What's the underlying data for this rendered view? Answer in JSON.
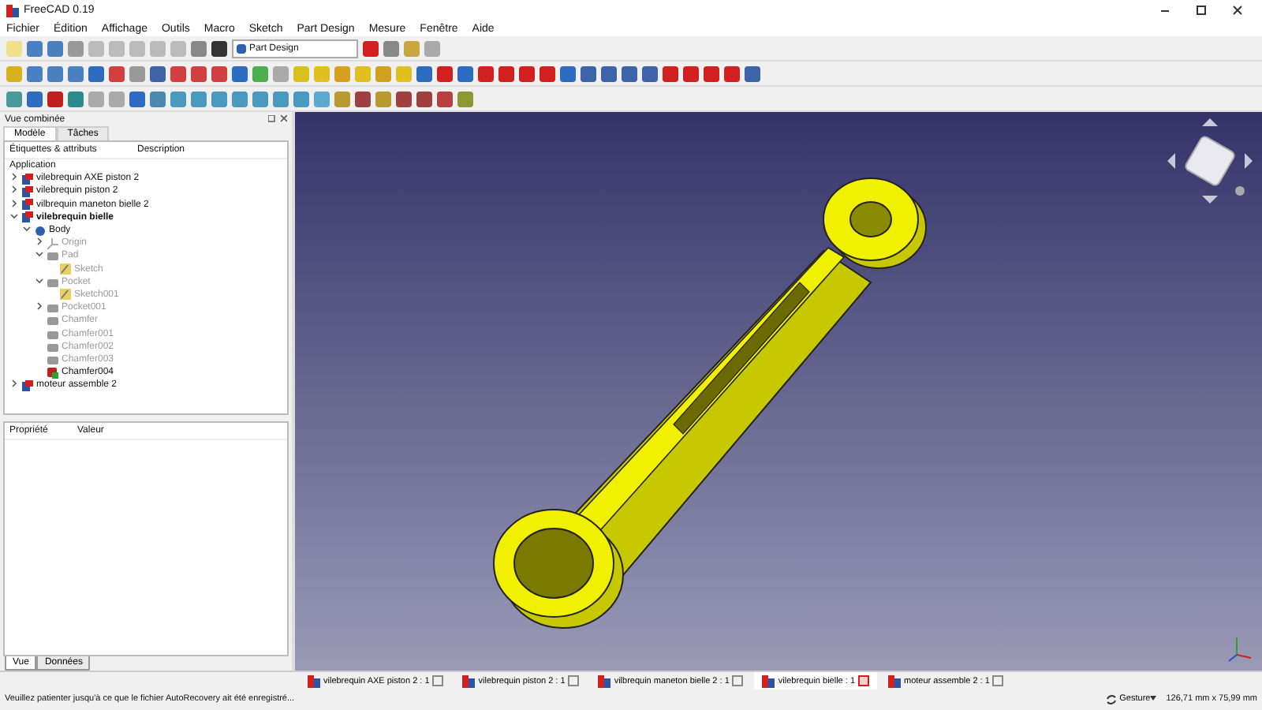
{
  "window": {
    "title": "FreeCAD 0.19"
  },
  "menu": [
    "Fichier",
    "Édition",
    "Affichage",
    "Outils",
    "Macro",
    "Sketch",
    "Part Design",
    "Mesure",
    "Fenêtre",
    "Aide"
  ],
  "workbench": {
    "value": "Part Design"
  },
  "combo_view": {
    "title": "Vue combinée",
    "tabs": [
      {
        "label": "Modèle",
        "selected": true
      },
      {
        "label": "Tâches",
        "selected": false
      }
    ],
    "tree": {
      "columns": [
        "Étiquettes & attributs",
        "Description"
      ],
      "root": "Application",
      "items": [
        {
          "label": "vilebrequin AXE piston 2",
          "kind": "document",
          "expanded": false,
          "active": false,
          "visible": true
        },
        {
          "label": "vilebrequin piston 2",
          "kind": "document",
          "expanded": false,
          "active": false,
          "visible": true
        },
        {
          "label": "vilbrequin maneton bielle 2",
          "kind": "document",
          "expanded": false,
          "active": false,
          "visible": true
        },
        {
          "label": "vilebrequin bielle",
          "kind": "document",
          "expanded": true,
          "active": true,
          "visible": true,
          "children": [
            {
              "label": "Body",
              "kind": "body",
              "expanded": true,
              "active": false,
              "visible": true,
              "children": [
                {
                  "label": "Origin",
                  "kind": "origin",
                  "expanded": false,
                  "active": false,
                  "visible": false
                },
                {
                  "label": "Pad",
                  "kind": "feature",
                  "expanded": true,
                  "active": false,
                  "visible": false,
                  "children": [
                    {
                      "label": "Sketch",
                      "kind": "sketch",
                      "active": false,
                      "visible": false
                    }
                  ]
                },
                {
                  "label": "Pocket",
                  "kind": "feature",
                  "expanded": true,
                  "active": false,
                  "visible": false,
                  "children": [
                    {
                      "label": "Sketch001",
                      "kind": "sketch",
                      "active": false,
                      "visible": false
                    }
                  ]
                },
                {
                  "label": "Pocket001",
                  "kind": "feature",
                  "expanded": false,
                  "active": false,
                  "visible": false
                },
                {
                  "label": "Chamfer",
                  "kind": "feature",
                  "active": false,
                  "visible": false
                },
                {
                  "label": "Chamfer001",
                  "kind": "feature",
                  "active": false,
                  "visible": false
                },
                {
                  "label": "Chamfer002",
                  "kind": "feature",
                  "active": false,
                  "visible": false
                },
                {
                  "label": "Chamfer003",
                  "kind": "feature",
                  "active": false,
                  "visible": false
                },
                {
                  "label": "Chamfer004",
                  "kind": "tip",
                  "active": false,
                  "visible": true
                }
              ]
            }
          ]
        },
        {
          "label": "moteur assemble 2",
          "kind": "document",
          "expanded": false,
          "active": false,
          "visible": true
        }
      ]
    },
    "properties": {
      "columns": [
        "Propriété",
        "Valeur"
      ]
    },
    "bottom_tabs": [
      {
        "label": "Vue",
        "selected": true
      },
      {
        "label": "Données",
        "selected": false
      }
    ]
  },
  "document_tabs": [
    {
      "label": "vilebrequin AXE piston 2 : 1",
      "selected": false
    },
    {
      "label": "vilebrequin piston 2 : 1",
      "selected": false
    },
    {
      "label": "vilbrequin maneton bielle 2 : 1",
      "selected": false
    },
    {
      "label": "vilebrequin bielle : 1",
      "selected": true
    },
    {
      "label": "moteur assemble 2 : 1",
      "selected": false
    }
  ],
  "status_bar": {
    "message": "Veuillez patienter jusqu'à ce que le fichier AutoRecovery ait été enregistré...",
    "navigation": "Gesture",
    "dimensions": "126,71 mm x 75,99 mm"
  }
}
